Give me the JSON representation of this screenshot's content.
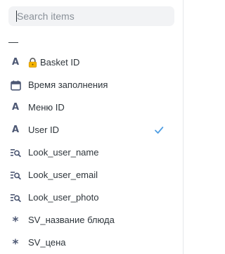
{
  "search": {
    "placeholder": "Search items",
    "value": ""
  },
  "dash_option": {
    "label": "—"
  },
  "items": [
    {
      "icon": "text-type-icon",
      "prefix_emoji": "lock-emoji",
      "label": "Basket ID",
      "selected": false
    },
    {
      "icon": "calendar-icon",
      "label": "Время заполнения",
      "selected": false
    },
    {
      "icon": "text-type-icon",
      "label": "Меню ID",
      "selected": false
    },
    {
      "icon": "text-type-icon",
      "label": "User ID",
      "selected": true
    },
    {
      "icon": "lookup-icon",
      "label": "Look_user_name",
      "selected": false
    },
    {
      "icon": "lookup-icon",
      "label": "Look_user_email",
      "selected": false
    },
    {
      "icon": "lookup-icon",
      "label": "Look_user_photo",
      "selected": false
    },
    {
      "icon": "formula-icon",
      "label": "SV_название блюда",
      "selected": false
    },
    {
      "icon": "formula-icon",
      "label": "SV_цена",
      "selected": false
    }
  ],
  "colors": {
    "accent": "#509ee3",
    "icon": "#4c5773",
    "text": "#2e353b",
    "search_bg": "#f2f3f5"
  }
}
